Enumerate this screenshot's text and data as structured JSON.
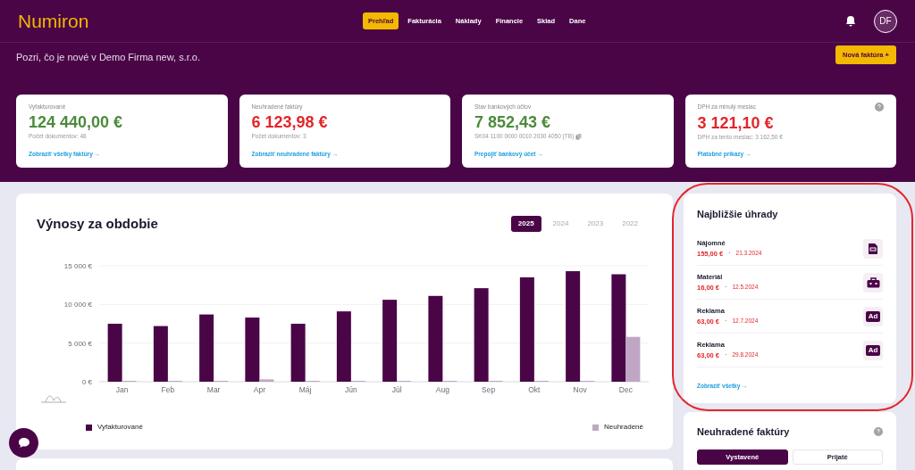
{
  "header": {
    "logo": "Numiron",
    "nav": [
      {
        "label": "Prehľad",
        "selected": true
      },
      {
        "label": "Fakturácia",
        "selected": false
      },
      {
        "label": "Náklady",
        "selected": false
      },
      {
        "label": "Financie",
        "selected": false
      },
      {
        "label": "Sklad",
        "selected": false
      },
      {
        "label": "Dane",
        "selected": false
      }
    ],
    "avatar": "DF"
  },
  "hero": {
    "subtitle": "Pozri, čo je nové v Demo Firma new, s.r.o.",
    "new_invoice_button": "Nová faktúra +"
  },
  "stat_cards": [
    {
      "label": "Vyfakturované",
      "value": "124 440,00 €",
      "color": "#4b8b3b",
      "detail": "Počet dokumentov: 48",
      "link": "Zobraziť všetky faktúry →",
      "help": false,
      "copy": false
    },
    {
      "label": "Neuhradené faktúry",
      "value": "6 123,98 €",
      "color": "#e3262b",
      "detail": "Počet dokumentov: 3",
      "link": "Zobraziť neuhradené faktúry →",
      "help": false,
      "copy": false
    },
    {
      "label": "Stav bankových účtov",
      "value": "7 852,43 €",
      "color": "#4b8b3b",
      "detail": "SK04 1100 0000 0010 2030 4050 (TB)",
      "link": "Prepojiť bankový účet →",
      "help": false,
      "copy": true
    },
    {
      "label": "DPH za minulý mesiac",
      "value": "3 121,10 €",
      "color": "#e3262b",
      "detail": "DPH za tento mesiac: 3 162,50 €",
      "link": "Platobné príkazy →",
      "help": true,
      "copy": false
    }
  ],
  "revenue": {
    "title": "Výnosy za obdobie",
    "years": [
      {
        "label": "2025",
        "selected": true
      },
      {
        "label": "2024",
        "selected": false
      },
      {
        "label": "2023",
        "selected": false
      },
      {
        "label": "2022",
        "selected": false
      }
    ],
    "chart_data": {
      "type": "bar",
      "categories": [
        "Jan",
        "Feb",
        "Mar",
        "Apr",
        "Máj",
        "Jún",
        "Júl",
        "Aug",
        "Sep",
        "Okt",
        "Nov",
        "Dec"
      ],
      "series": [
        {
          "name": "Vyfakturované",
          "color": "#4a0547",
          "values": [
            7500,
            7200,
            8700,
            8300,
            7500,
            9100,
            10600,
            11100,
            12100,
            13500,
            14300,
            13900
          ]
        },
        {
          "name": "Neuhradené",
          "color": "#c0a6c4",
          "values": [
            0,
            0,
            0,
            300,
            0,
            0,
            0,
            0,
            0,
            0,
            0,
            5800
          ]
        }
      ],
      "legend": true,
      "ylim": [
        0,
        15000
      ],
      "yticks": [
        {
          "value": 0,
          "label": "0 €"
        },
        {
          "value": 5000,
          "label": "5 000 €"
        },
        {
          "value": 10000,
          "label": "10 000 €"
        },
        {
          "value": 15000,
          "label": "15 000 €"
        }
      ]
    }
  },
  "upcoming": {
    "title": "Najbližšie úhrady",
    "highlighted": true,
    "items": [
      {
        "name": "Nájomné",
        "amount": "155,00 €",
        "separator": "·",
        "date": "21.3.2024",
        "kind": "document"
      },
      {
        "name": "Materiál",
        "amount": "16,00 €",
        "separator": "·",
        "date": "12.5.2024",
        "kind": "toolbox"
      },
      {
        "name": "Reklama",
        "amount": "63,00 €",
        "separator": "·",
        "date": "12.7.2024",
        "kind": "ad",
        "badge": "Ad"
      },
      {
        "name": "Reklama",
        "amount": "63,00 €",
        "separator": "·",
        "date": "29.8.2024",
        "kind": "ad",
        "badge": "Ad"
      }
    ],
    "link": "Zobraziť všetky →"
  },
  "unpaid": {
    "title": "Neuhradené faktúry",
    "tabs": [
      {
        "label": "Vystavené",
        "selected": true
      },
      {
        "label": "Prijaté",
        "selected": false
      }
    ]
  }
}
